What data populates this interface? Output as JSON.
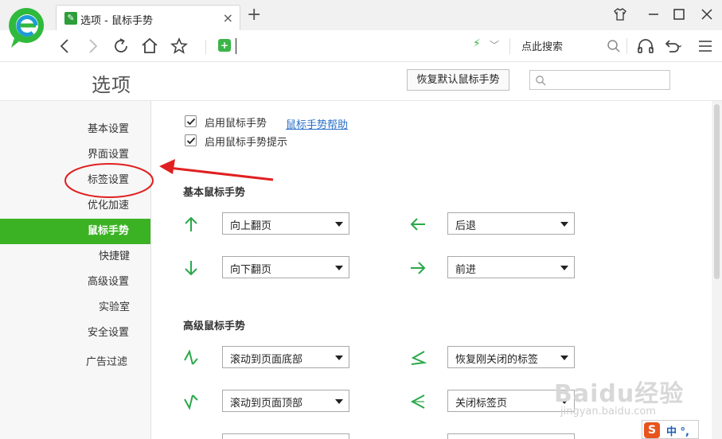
{
  "browser": {
    "tab_title": "选项 - 鼠标手势",
    "tab_close": "×",
    "new_tab": "+",
    "search_hint": "点此搜索"
  },
  "options": {
    "title": "选项",
    "reset_button": "恢复默认鼠标手势",
    "search_placeholder": ""
  },
  "sidebar": {
    "items": [
      {
        "label": "基本设置"
      },
      {
        "label": "界面设置"
      },
      {
        "label": "标签设置"
      },
      {
        "label": "优化加速"
      },
      {
        "label": "鼠标手势"
      },
      {
        "label": "快捷键"
      },
      {
        "label": "高级设置"
      },
      {
        "label": "实验室"
      },
      {
        "label": "安全设置"
      },
      {
        "label": "广告过滤"
      }
    ],
    "active_index": 4
  },
  "content": {
    "enable_gesture": {
      "label": "启用鼠标手势",
      "checked": true
    },
    "help_link": "鼠标手势帮助",
    "enable_hint": {
      "label": "启用鼠标手势提示",
      "checked": true
    },
    "basic_title": "基本鼠标手势",
    "basic": [
      {
        "gesture": "arrow-up",
        "action": "向上翻页"
      },
      {
        "gesture": "arrow-left",
        "action": "后退"
      },
      {
        "gesture": "arrow-down",
        "action": "向下翻页"
      },
      {
        "gesture": "arrow-right",
        "action": "前进"
      }
    ],
    "advanced_title": "高级鼠标手势",
    "advanced": [
      {
        "gesture": "down-right-zigzag",
        "action": "滚动到页面底部"
      },
      {
        "gesture": "left-down-zigzag",
        "action": "恢复刚关闭的标签"
      },
      {
        "gesture": "up-right-zigzag",
        "action": "滚动到页面顶部"
      },
      {
        "gesture": "left-right-zigzag",
        "action": "关闭标签页"
      }
    ]
  },
  "watermark": {
    "line1": "Baidu经验",
    "line2": "jingyan.baidu.com"
  },
  "ime": {
    "logo": "S",
    "text": "中 °,"
  },
  "colors": {
    "accent": "#3bb224",
    "arrow": "#2aa84a",
    "annotation": "#e02020",
    "link": "#2a6fc9"
  }
}
